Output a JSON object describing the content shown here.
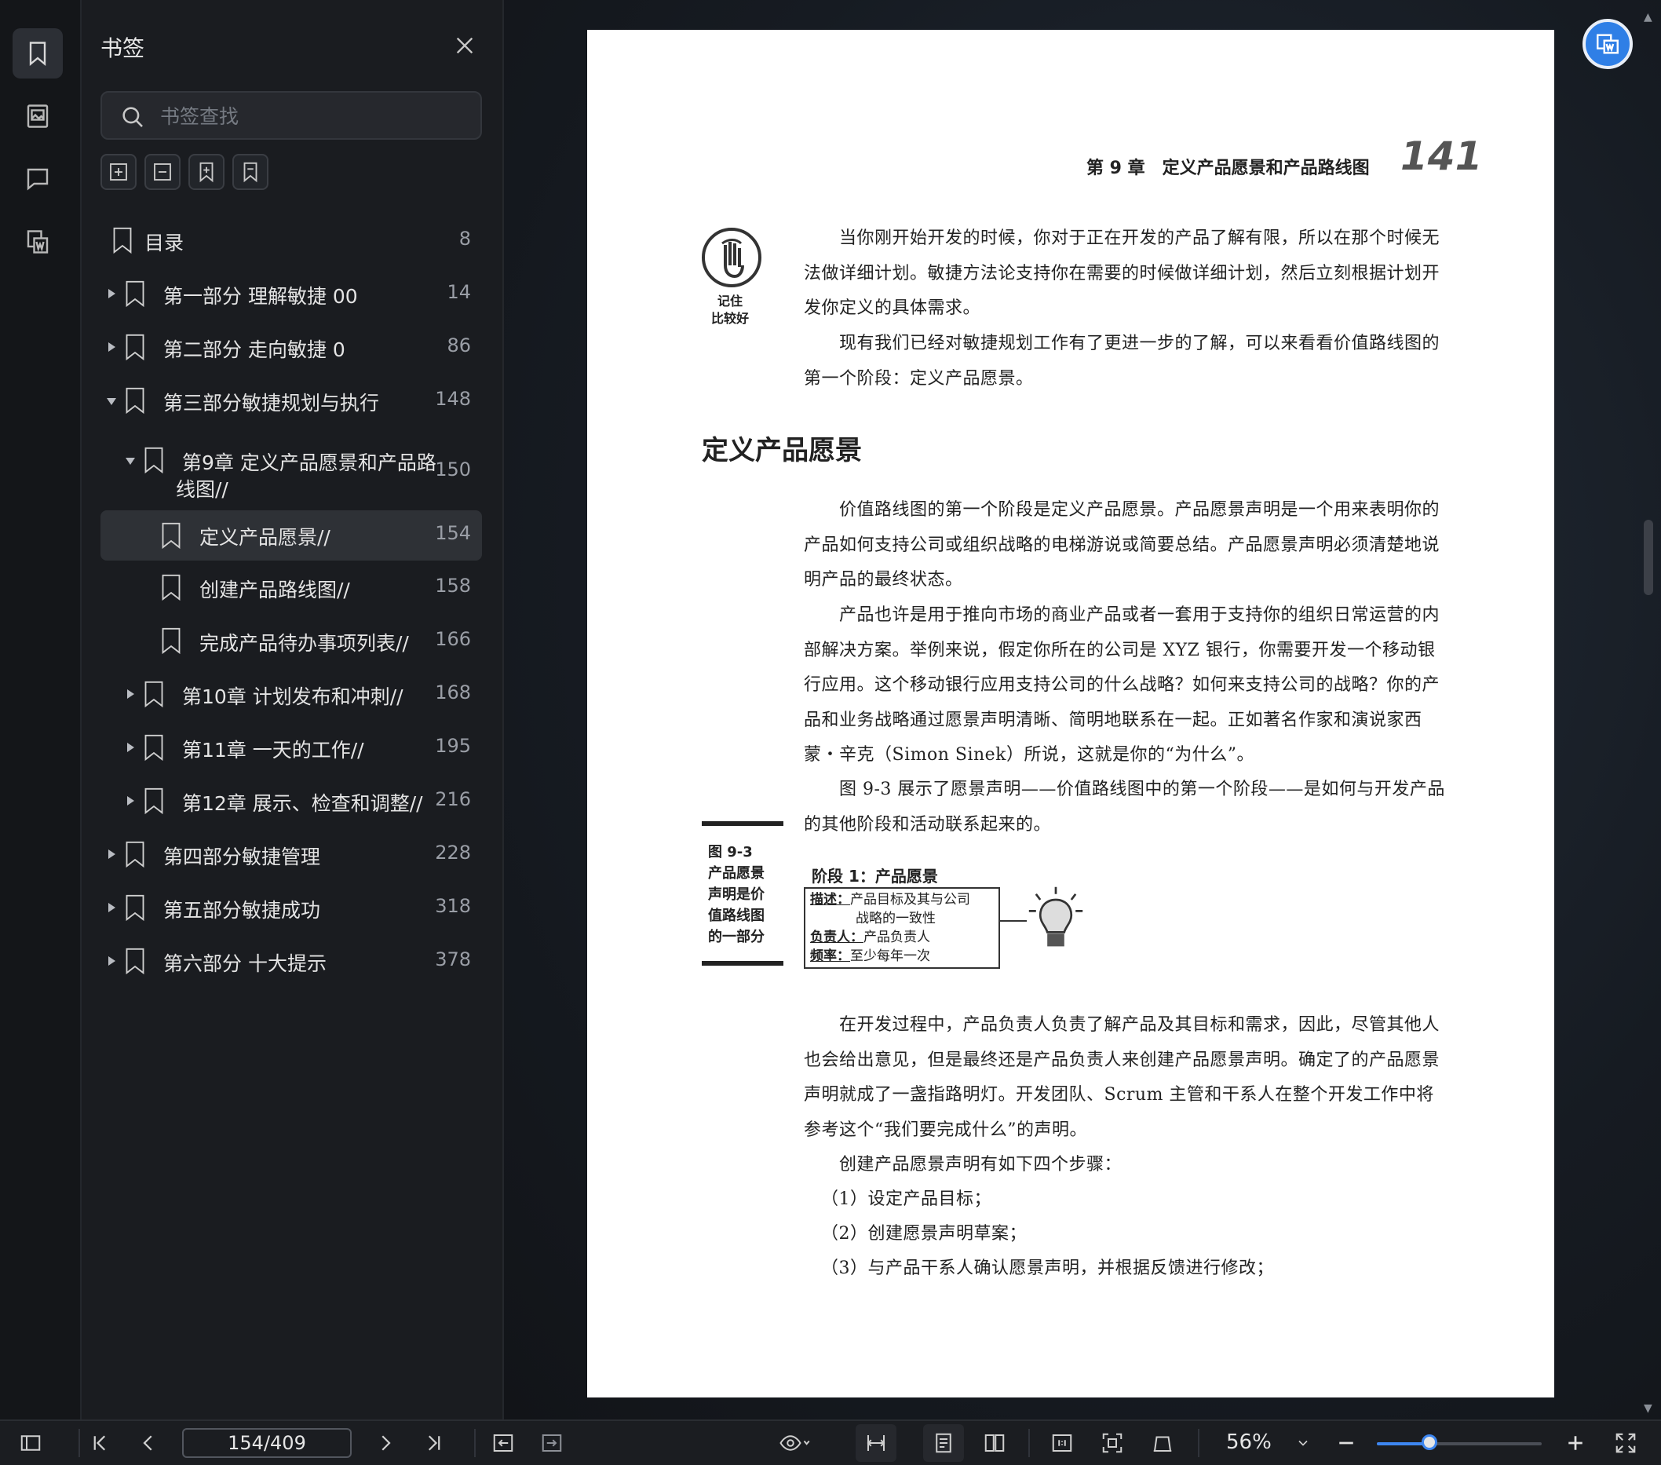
{
  "panel": {
    "title": "书签",
    "search_placeholder": "书签查找",
    "bookmarks": [
      {
        "label": "目录",
        "page": "8"
      },
      {
        "label": "第一部分 理解敏捷 00",
        "page": "14"
      },
      {
        "label": "第二部分 走向敏捷 0",
        "page": "86"
      },
      {
        "label": "第三部分敏捷规划与执行",
        "page": "148"
      },
      {
        "label": "第9章 定义产品愿景和产品路",
        "label2": "线图//",
        "page": "150"
      },
      {
        "label": "定义产品愿景//",
        "page": "154"
      },
      {
        "label": "创建产品路线图//",
        "page": "158"
      },
      {
        "label": "完成产品待办事项列表//",
        "page": "166"
      },
      {
        "label": "第10章 计划发布和冲刺//",
        "page": "168"
      },
      {
        "label": "第11章 一天的工作//",
        "page": "195"
      },
      {
        "label": "第12章 展示、检查和调整//",
        "page": "216"
      },
      {
        "label": "第四部分敏捷管理",
        "page": "228"
      },
      {
        "label": "第五部分敏捷成功",
        "page": "318"
      },
      {
        "label": "第六部分 十大提示",
        "page": "378"
      }
    ]
  },
  "document": {
    "header_chapter": "第 9 章　定义产品愿景和产品路线图",
    "page_number": "141",
    "remember_icon_label_1": "记住",
    "remember_icon_label_2": "比较好",
    "para1": "当你刚开始开发的时候，你对于正在开发的产品了解有限，所以在那个时候无法做详细计划。敏捷方法论支持你在需要的时候做详细计划，然后立刻根据计划开发你定义的具体需求。",
    "para2": "现有我们已经对敏捷规划工作有了更进一步的了解，可以来看看价值路线图的第一个阶段：定义产品愿景。",
    "section_title": "定义产品愿景",
    "para3": "价值路线图的第一个阶段是定义产品愿景。产品愿景声明是一个用来表明你的产品如何支持公司或组织战略的电梯游说或简要总结。产品愿景声明必须清楚地说明产品的最终状态。",
    "para4": "产品也许是用于推向市场的商业产品或者一套用于支持你的组织日常运营的内部解决方案。举例来说，假定你所在的公司是 XYZ 银行，你需要开发一个移动银行应用。这个移动银行应用支持公司的什么战略？如何来支持公司的战略？你的产品和业务战略通过愿景声明清晰、简明地联系在一起。正如著名作家和演说家西蒙・辛克（Simon Sinek）所说，这就是你的“为什么”。",
    "para5": "图 9-3 展示了愿景声明——价值路线图中的第一个阶段——是如何与开发产品的其他阶段和活动联系起来的。",
    "figure": {
      "caption_title": "图 9-3",
      "caption_lines": [
        "产品愿景",
        "声明是价",
        "值路线图",
        "的一部分"
      ],
      "stage_title": "阶段 1：产品愿景",
      "desc_label": "描述：",
      "desc_text": "产品目标及其与公司",
      "desc_text2": "战略的一致性",
      "owner_label": "负责人：",
      "owner_text": "产品负责人",
      "freq_label": "频率：",
      "freq_text": "至少每年一次"
    },
    "para6": "在开发过程中，产品负责人负责了解产品及其目标和需求，因此，尽管其他人也会给出意见，但是最终还是产品负责人来创建产品愿景声明。确定了的产品愿景声明就成了一盏指路明灯。开发团队、Scrum 主管和干系人在整个开发工作中将参考这个“我们要完成什么”的声明。",
    "para7": "创建产品愿景声明有如下四个步骤：",
    "step1": "（1）设定产品目标；",
    "step2": "（2）创建愿景声明草案；",
    "step3": "（3）与产品干系人确认愿景声明，并根据反馈进行修改；"
  },
  "toolbar": {
    "page_indicator": "154/409",
    "zoom": "56%",
    "zoom_fraction": 0.32
  }
}
